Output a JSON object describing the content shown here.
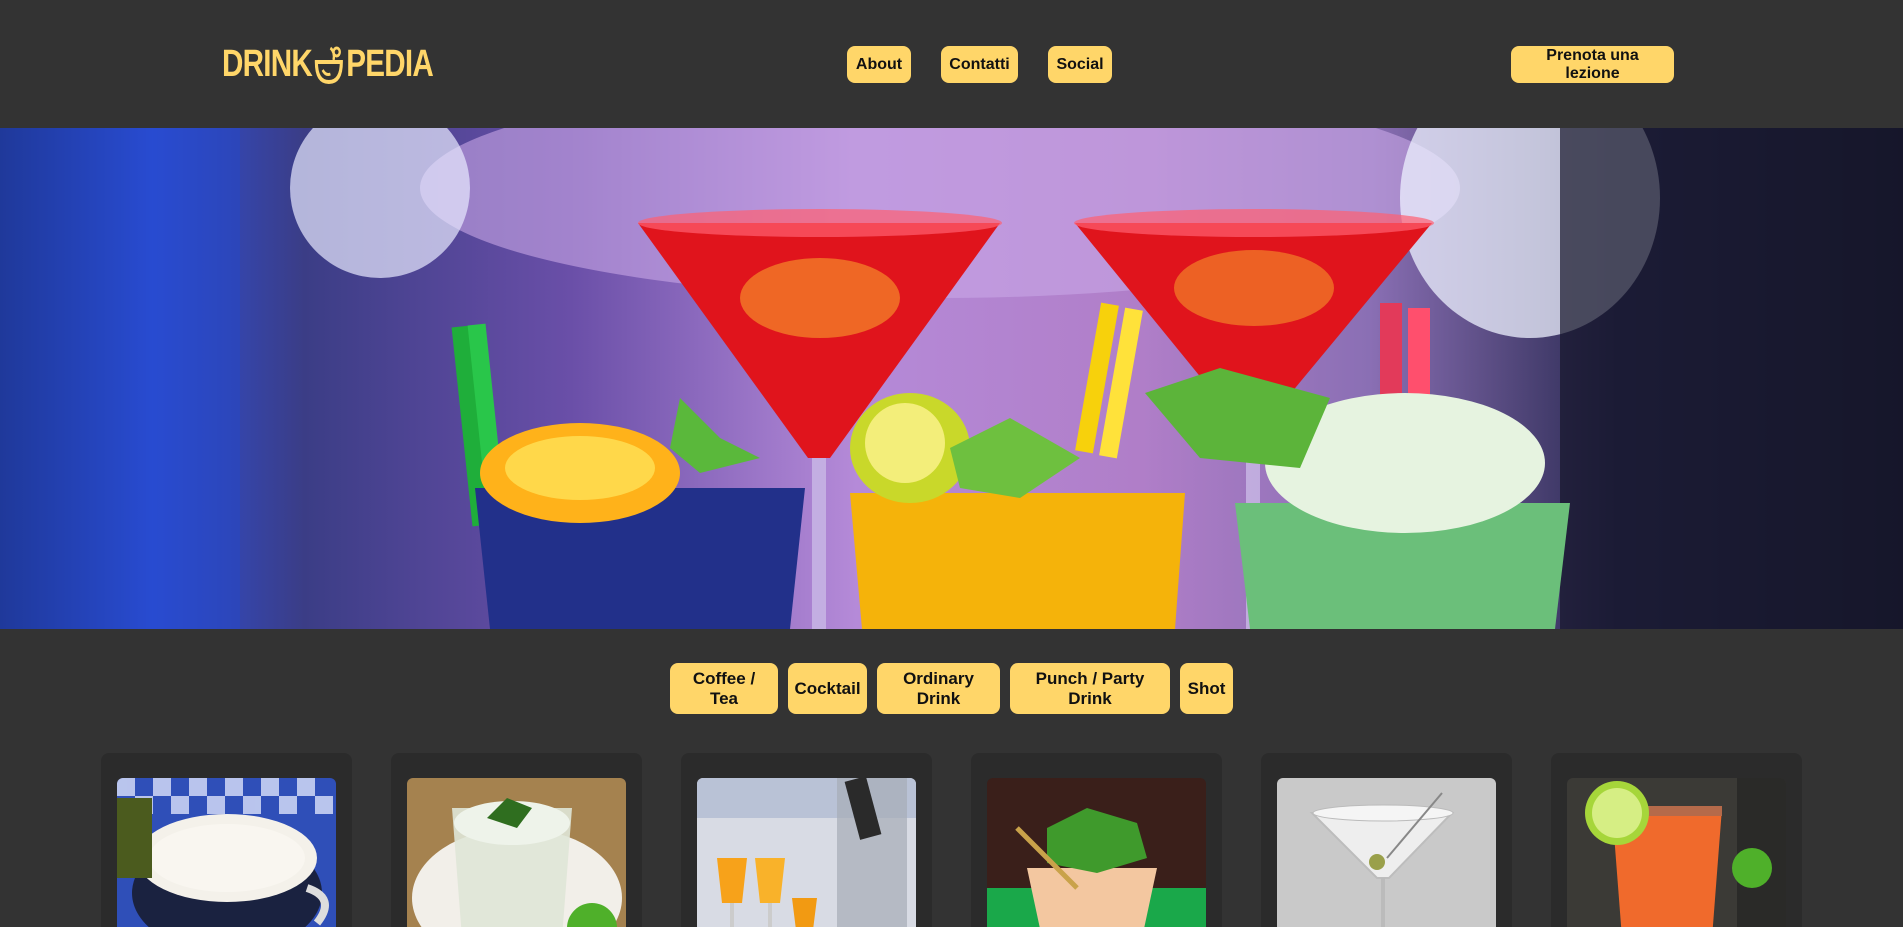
{
  "header": {
    "logo_text_left": "DRINK",
    "logo_text_right": "PEDIA",
    "nav": [
      {
        "label": "About"
      },
      {
        "label": "Contatti"
      },
      {
        "label": "Social"
      }
    ],
    "cta_label": "Prenota una lezione"
  },
  "hero": {
    "image": "cocktails-hero"
  },
  "categories": [
    {
      "label": "Coffee / Tea"
    },
    {
      "label": "Cocktail"
    },
    {
      "label": "Ordinary Drink"
    },
    {
      "label": "Punch / Party Drink"
    },
    {
      "label": "Shot"
    }
  ],
  "cards": [
    {
      "image": "cappuccino-cup"
    },
    {
      "image": "mojito-glass"
    },
    {
      "image": "mimosa-glasses"
    },
    {
      "image": "mint-julep"
    },
    {
      "image": "martini-olive"
    },
    {
      "image": "paloma-lime"
    }
  ],
  "colors": {
    "background": "#333333",
    "accent": "#ffd669",
    "card_bg": "#2b2b2b",
    "text_dark": "#111111"
  }
}
